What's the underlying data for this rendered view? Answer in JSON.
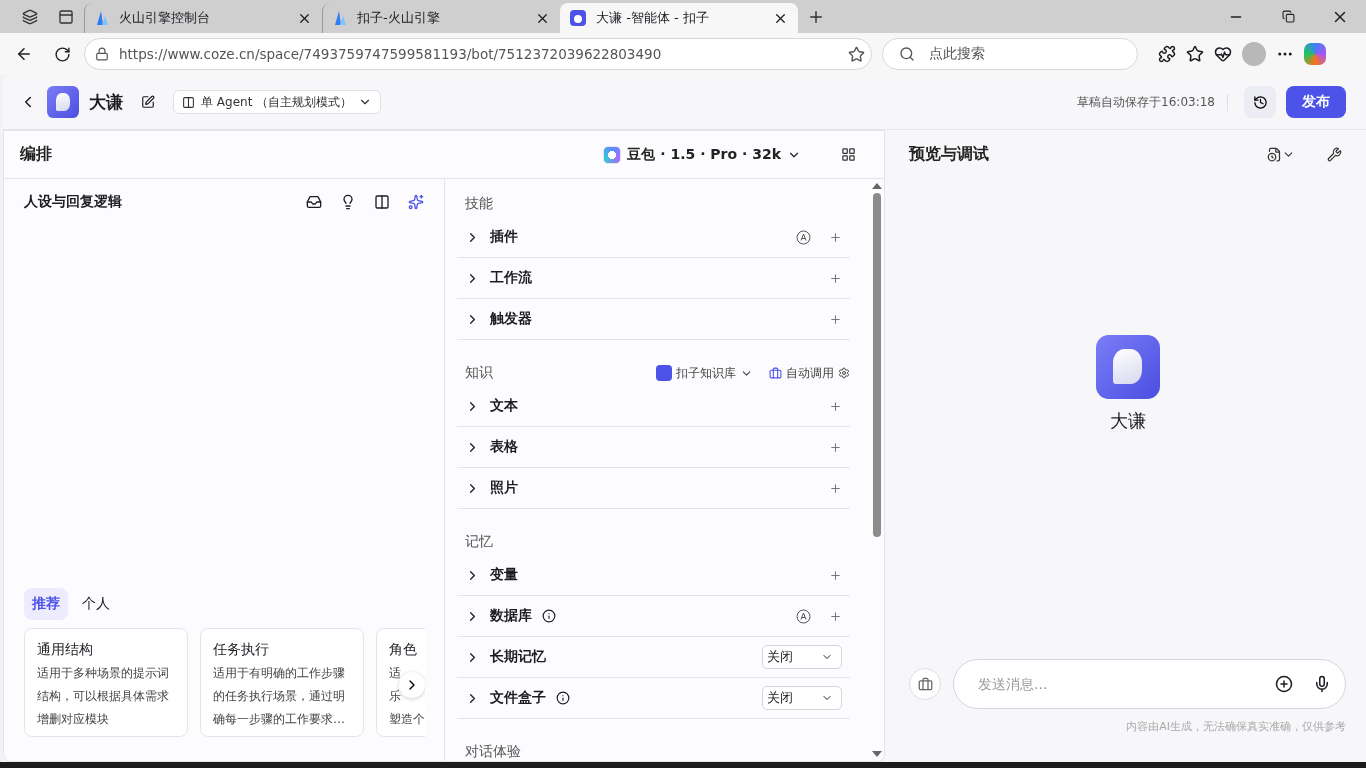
{
  "browser": {
    "tabs": [
      {
        "title": "火山引擎控制台",
        "selected": false,
        "kind": "volcano"
      },
      {
        "title": "扣子-火山引擎",
        "selected": false,
        "kind": "volcano"
      },
      {
        "title": "大谦 -智能体 - 扣子",
        "selected": true,
        "kind": "coze"
      }
    ],
    "url": "https://www.coze.cn/space/7493759747599581193/bot/7512372039622803490",
    "search_placeholder": "点此搜索"
  },
  "header": {
    "bot_name": "大谦",
    "mode": "单 Agent （自主规划模式）",
    "save_status": "草稿自动保存于16:03:18",
    "publish": "发布"
  },
  "editor": {
    "title": "编排",
    "model": "豆包 · 1.5 · Pro · 32k"
  },
  "persona": {
    "title": "人设与回复逻辑",
    "template_tabs": [
      {
        "label": "推荐",
        "selected": true
      },
      {
        "label": "个人",
        "selected": false
      }
    ],
    "cards": [
      {
        "title": "通用结构",
        "lines": [
          "适用于多种场景的提示词",
          "结构，可以根据具体需求",
          "增删对应模块"
        ]
      },
      {
        "title": "任务执行",
        "lines": [
          "适用于有明确的工作步骤",
          "的任务执行场景，通过明",
          "确每一步骤的工作要求…"
        ]
      },
      {
        "title": "角色",
        "lines": [
          "适",
          "乐",
          "塑造个"
        ]
      }
    ]
  },
  "sections": [
    {
      "title": "技能",
      "items": [
        {
          "label": "插件",
          "info": false,
          "auto": true,
          "kind": "add"
        },
        {
          "label": "工作流",
          "info": false,
          "auto": false,
          "kind": "add"
        },
        {
          "label": "触发器",
          "info": false,
          "auto": false,
          "kind": "add"
        }
      ]
    },
    {
      "title": "知识",
      "source": "扣子知识库",
      "auto_call": "自动调用",
      "items": [
        {
          "label": "文本",
          "info": false,
          "auto": false,
          "kind": "add"
        },
        {
          "label": "表格",
          "info": false,
          "auto": false,
          "kind": "add"
        },
        {
          "label": "照片",
          "info": false,
          "auto": false,
          "kind": "add"
        }
      ]
    },
    {
      "title": "记忆",
      "items": [
        {
          "label": "变量",
          "info": false,
          "auto": false,
          "kind": "add"
        },
        {
          "label": "数据库",
          "info": true,
          "auto": true,
          "kind": "add"
        },
        {
          "label": "长期记忆",
          "info": false,
          "auto": false,
          "kind": "select",
          "value": "关闭"
        },
        {
          "label": "文件盒子",
          "info": true,
          "auto": false,
          "kind": "select",
          "value": "关闭"
        }
      ]
    },
    {
      "title": "对话体验"
    }
  ],
  "preview": {
    "title": "预览与调试",
    "bot_name": "大谦",
    "input_placeholder": "发送消息...",
    "disclaimer": "内容由AI生成，无法确保真实准确，仅供参考"
  }
}
